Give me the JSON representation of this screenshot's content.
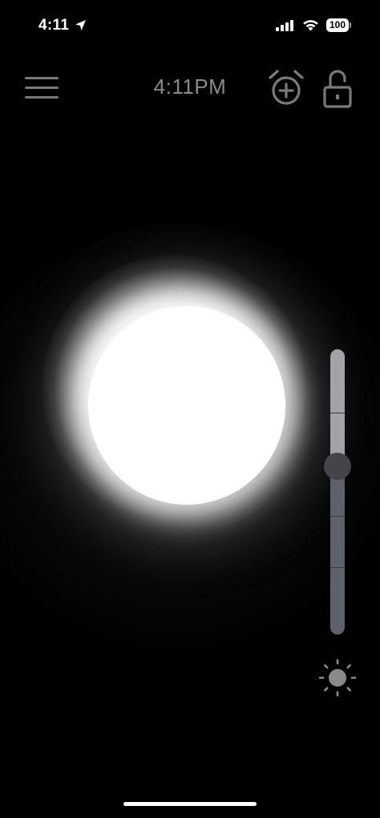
{
  "status_bar": {
    "time": "4:11",
    "battery_level": "100",
    "icons": [
      "location-arrow-icon",
      "cellular-signal-icon",
      "wifi-icon",
      "battery-icon"
    ]
  },
  "header": {
    "time": "4:11PM",
    "icons": [
      "menu-icon",
      "alarm-add-icon",
      "unlock-icon"
    ]
  },
  "light": {
    "color": "#ffffff"
  },
  "brightness": {
    "level_fraction": 0.41,
    "icon": "sun-icon"
  },
  "colors": {
    "background": "#000000",
    "header_text": "#8a8a8a",
    "slider_track": "#5e6168",
    "slider_fill": "#a2a3a6",
    "slider_thumb": "#434548"
  }
}
